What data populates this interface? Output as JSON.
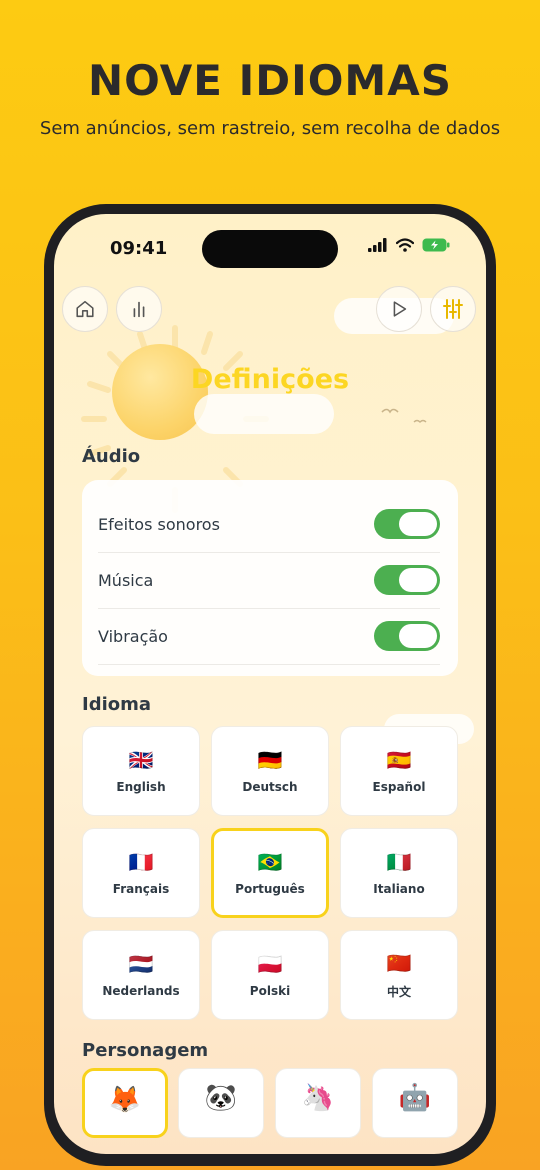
{
  "banner": {
    "headline": "NOVE IDIOMAS",
    "subheadline": "Sem anúncios, sem rastreio, sem recolha de dados"
  },
  "status_bar": {
    "time": "09:41"
  },
  "toolbar": {
    "left": [
      {
        "icon": "home-icon"
      },
      {
        "icon": "bar-chart-icon"
      }
    ],
    "right": [
      {
        "icon": "play-icon"
      },
      {
        "icon": "sliders-icon"
      }
    ]
  },
  "page": {
    "title": "Definições"
  },
  "audio": {
    "label": "Áudio",
    "rows": [
      {
        "label": "Efeitos sonoros",
        "enabled": true
      },
      {
        "label": "Música",
        "enabled": true
      },
      {
        "label": "Vibração",
        "enabled": true
      }
    ]
  },
  "language": {
    "label": "Idioma",
    "selected": "Português",
    "items": [
      {
        "flag": "🇬🇧",
        "name": "English"
      },
      {
        "flag": "🇩🇪",
        "name": "Deutsch"
      },
      {
        "flag": "🇪🇸",
        "name": "Español"
      },
      {
        "flag": "🇫🇷",
        "name": "Français"
      },
      {
        "flag": "🇧🇷",
        "name": "Português"
      },
      {
        "flag": "🇮🇹",
        "name": "Italiano"
      },
      {
        "flag": "🇳🇱",
        "name": "Nederlands"
      },
      {
        "flag": "🇵🇱",
        "name": "Polski"
      },
      {
        "flag": "🇨🇳",
        "name": "中文"
      }
    ]
  },
  "character": {
    "label": "Personagem",
    "items": [
      {
        "emoji": "🦊",
        "selected": true
      },
      {
        "emoji": "🐼",
        "selected": false
      },
      {
        "emoji": "🦄",
        "selected": false
      },
      {
        "emoji": "🤖",
        "selected": false
      }
    ]
  },
  "colors": {
    "accent": "#FCD623",
    "toggle_on": "#4CAF50",
    "battery": "#3DBA4E"
  }
}
